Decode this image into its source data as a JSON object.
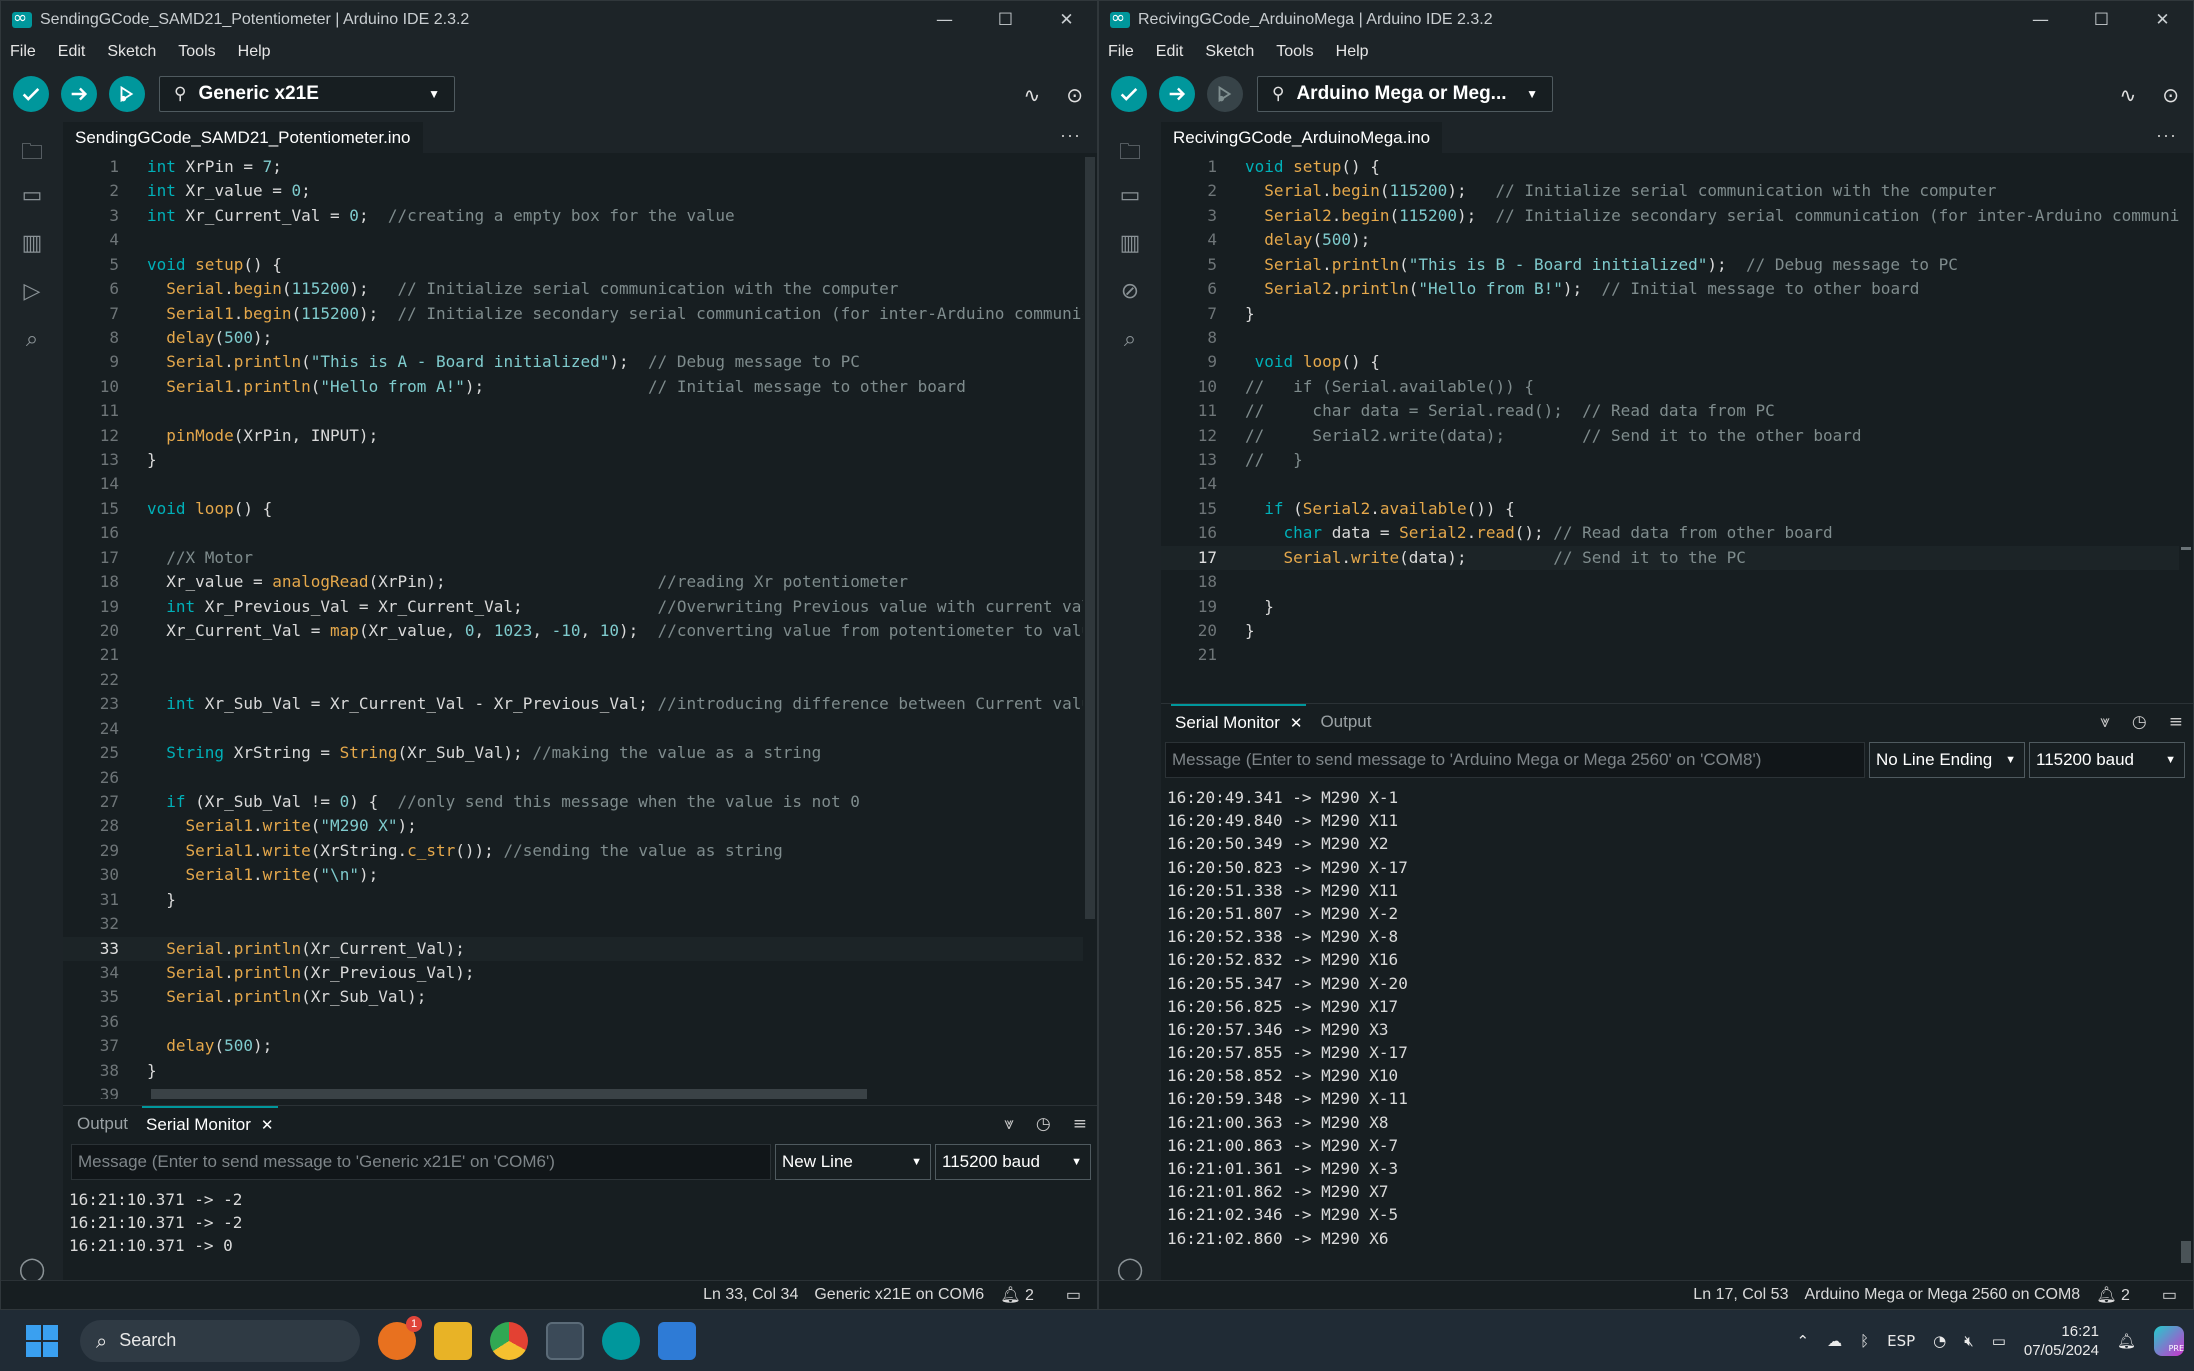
{
  "left": {
    "title": "SendingGCode_SAMD21_Potentiometer | Arduino IDE 2.3.2",
    "menu": [
      "File",
      "Edit",
      "Sketch",
      "Tools",
      "Help"
    ],
    "board": "Generic x21E",
    "file_tab": "SendingGCode_SAMD21_Potentiometer.ino",
    "code": [
      "<span class=\"kw\">int</span> XrPin = <span class=\"num\">7</span>;",
      "<span class=\"kw\">int</span> Xr_value = <span class=\"num\">0</span>;",
      "<span class=\"kw\">int</span> Xr_Current_Val = <span class=\"num\">0</span>;  <span class=\"cm\">//creating a empty box for the value</span>",
      "",
      "<span class=\"kw\">void</span> <span class=\"fn\">setup</span>() {",
      "  <span class=\"ob\">Serial</span>.<span class=\"fn\">begin</span>(<span class=\"num\">115200</span>);   <span class=\"cm\">// Initialize serial communication with the computer</span>",
      "  <span class=\"ob\">Serial1</span>.<span class=\"fn\">begin</span>(<span class=\"num\">115200</span>);  <span class=\"cm\">// Initialize secondary serial communication (for inter-Arduino communication)</span>",
      "  <span class=\"fn\">delay</span>(<span class=\"num\">500</span>);",
      "  <span class=\"ob\">Serial</span>.<span class=\"fn\">println</span>(<span class=\"str\">\"This is A - Board initialized\"</span>);  <span class=\"cm\">// Debug message to PC</span>",
      "  <span class=\"ob\">Serial1</span>.<span class=\"fn\">println</span>(<span class=\"str\">\"Hello from A!\"</span>);                 <span class=\"cm\">// Initial message to other board</span>",
      "",
      "  <span class=\"fn\">pinMode</span>(XrPin, INPUT);",
      "}",
      "",
      "<span class=\"kw\">void</span> <span class=\"fn\">loop</span>() {",
      "",
      "  <span class=\"cm\">//X Motor</span>",
      "  Xr_value = <span class=\"fn\">analogRead</span>(XrPin);                      <span class=\"cm\">//reading Xr potentiometer</span>",
      "  <span class=\"kw\">int</span> Xr_Previous_Val = Xr_Current_Val;              <span class=\"cm\">//Overwriting Previous value with current value</span>",
      "  Xr_Current_Val = <span class=\"fn\">map</span>(Xr_value, <span class=\"num\">0</span>, <span class=\"num\">1023</span>, <span class=\"num\">-10</span>, <span class=\"num\">10</span>);  <span class=\"cm\">//converting value from potentiometer to values</span>",
      "",
      "",
      "  <span class=\"kw\">int</span> Xr_Sub_Val = Xr_Current_Val - Xr_Previous_Val; <span class=\"cm\">//introducing difference between Current value</span>",
      "",
      "  <span class=\"kw\">String</span> XrString = <span class=\"fn\">String</span>(Xr_Sub_Val); <span class=\"cm\">//making the value as a string</span>",
      "",
      "  <span class=\"kw\">if</span> (Xr_Sub_Val != <span class=\"num\">0</span>) {  <span class=\"cm\">//only send this message when the value is not 0</span>",
      "    <span class=\"ob\">Serial1</span>.<span class=\"fn\">write</span>(<span class=\"str\">\"M290 X\"</span>);",
      "    <span class=\"ob\">Serial1</span>.<span class=\"fn\">write</span>(XrString.<span class=\"fn\">c_str</span>()); <span class=\"cm\">//sending the value as string</span>",
      "    <span class=\"ob\">Serial1</span>.<span class=\"fn\">write</span>(<span class=\"str\">\"\\n\"</span>);",
      "  }",
      "",
      "  <span class=\"ob\">Serial</span>.<span class=\"fn\">println</span>(Xr_Current_Val);",
      "  <span class=\"ob\">Serial</span>.<span class=\"fn\">println</span>(Xr_Previous_Val);",
      "  <span class=\"ob\">Serial</span>.<span class=\"fn\">println</span>(Xr_Sub_Val);",
      "",
      "  <span class=\"fn\">delay</span>(<span class=\"num\">500</span>);",
      "}",
      ""
    ],
    "current_line": 33,
    "panel": {
      "tabs": [
        "Output",
        "Serial Monitor"
      ],
      "message_placeholder": "Message (Enter to send message to 'Generic x21E' on 'COM6')",
      "line_ending": "New Line",
      "baud": "115200 baud",
      "output": [
        "16:21:10.371 -> -2",
        "16:21:10.371 -> -2",
        "16:21:10.371 -> 0"
      ]
    },
    "status": {
      "position": "Ln 33, Col 34",
      "board": "Generic x21E on COM6",
      "notifications": "2"
    }
  },
  "right": {
    "title": "RecivingGCode_ArduinoMega | Arduino IDE 2.3.2",
    "menu": [
      "File",
      "Edit",
      "Sketch",
      "Tools",
      "Help"
    ],
    "board": "Arduino Mega or Meg...",
    "file_tab": "RecivingGCode_ArduinoMega.ino",
    "code": [
      "<span class=\"kw\">void</span> <span class=\"fn\">setup</span>() {",
      "  <span class=\"ob\">Serial</span>.<span class=\"fn\">begin</span>(<span class=\"num\">115200</span>);   <span class=\"cm\">// Initialize serial communication with the computer</span>",
      "  <span class=\"ob\">Serial2</span>.<span class=\"fn\">begin</span>(<span class=\"num\">115200</span>);  <span class=\"cm\">// Initialize secondary serial communication (for inter-Arduino communication)</span>",
      "  <span class=\"fn\">delay</span>(<span class=\"num\">500</span>);",
      "  <span class=\"ob\">Serial</span>.<span class=\"fn\">println</span>(<span class=\"str\">\"This is B - Board initialized\"</span>);  <span class=\"cm\">// Debug message to PC</span>",
      "  <span class=\"ob\">Serial2</span>.<span class=\"fn\">println</span>(<span class=\"str\">\"Hello from B!\"</span>);  <span class=\"cm\">// Initial message to other board</span>",
      "}",
      "",
      " <span class=\"kw\">void</span> <span class=\"fn\">loop</span>() {",
      "<span class=\"cm\">//   if (Serial.available()) {</span>",
      "<span class=\"cm\">//     char data = Serial.read();  // Read data from PC</span>",
      "<span class=\"cm\">//     Serial2.write(data);        // Send it to the other board</span>",
      "<span class=\"cm\">//   }</span>",
      "",
      "  <span class=\"kw\">if</span> (<span class=\"ob\">Serial2</span>.<span class=\"fn\">available</span>()) {",
      "    <span class=\"kw\">char</span> data = <span class=\"ob\">Serial2</span>.<span class=\"fn\">read</span>(); <span class=\"cm\">// Read data from other board</span>",
      "    <span class=\"ob\">Serial</span>.<span class=\"fn\">write</span>(data);         <span class=\"cm\">// Send it to the PC</span>",
      "",
      "  }",
      "}",
      ""
    ],
    "current_line": 17,
    "panel": {
      "tabs": [
        "Serial Monitor",
        "Output"
      ],
      "message_placeholder": "Message (Enter to send message to 'Arduino Mega or Mega 2560' on 'COM8')",
      "line_ending": "No Line Ending",
      "baud": "115200 baud",
      "output": [
        "16:20:49.341 -> M290 X-1",
        "16:20:49.840 -> M290 X11",
        "16:20:50.349 -> M290 X2",
        "16:20:50.823 -> M290 X-17",
        "16:20:51.338 -> M290 X11",
        "16:20:51.807 -> M290 X-2",
        "16:20:52.338 -> M290 X-8",
        "16:20:52.832 -> M290 X16",
        "16:20:55.347 -> M290 X-20",
        "16:20:56.825 -> M290 X17",
        "16:20:57.346 -> M290 X3",
        "16:20:57.855 -> M290 X-17",
        "16:20:58.852 -> M290 X10",
        "16:20:59.348 -> M290 X-11",
        "16:21:00.363 -> M290 X8",
        "16:21:00.863 -> M290 X-7",
        "16:21:01.361 -> M290 X-3",
        "16:21:01.862 -> M290 X7",
        "16:21:02.346 -> M290 X-5",
        "16:21:02.860 -> M290 X6"
      ]
    },
    "status": {
      "position": "Ln 17, Col 53",
      "board": "Arduino Mega or Mega 2560 on COM8",
      "notifications": "2"
    }
  },
  "taskbar": {
    "search_label": "Search",
    "notification_badge": "1",
    "language": "ESP",
    "time": "16:21",
    "date": "07/05/2024",
    "copilot_badge": "PRE"
  },
  "colors": {
    "accent": "#00979c",
    "editor_bg": "#171e21",
    "taskbar_bg": "#202b35"
  }
}
